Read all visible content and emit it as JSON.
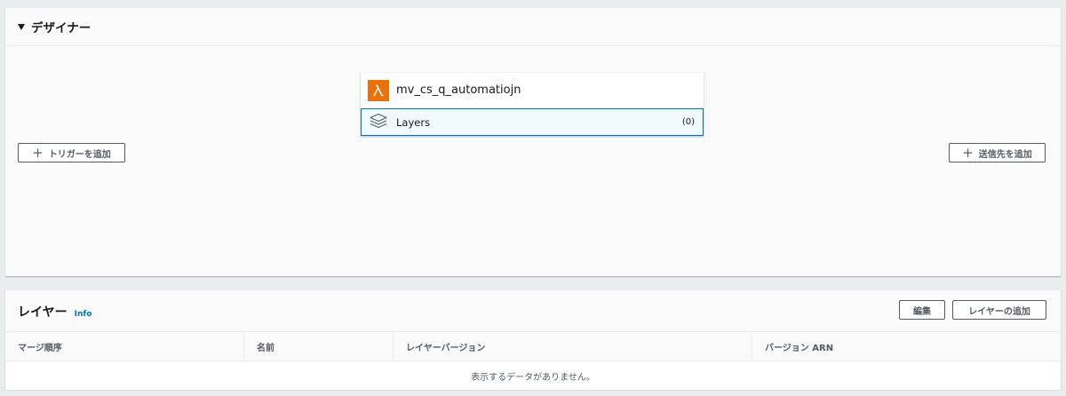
{
  "designer": {
    "title": "デザイナー",
    "function": {
      "name": "mv_cs_q_automatiojn",
      "icon": "lambda-icon",
      "icon_color": "#e8730c",
      "layers_label": "Layers",
      "layers_count": "(0)"
    },
    "add_trigger_label": "トリガーを追加",
    "add_destination_label": "送信先を追加"
  },
  "layers": {
    "title": "レイヤー",
    "info_label": "Info",
    "edit_label": "編集",
    "add_layer_label": "レイヤーの追加",
    "columns": [
      "マージ順序",
      "名前",
      "レイヤーバージョン",
      "バージョン ARN"
    ],
    "empty_message": "表示するデータがありません。"
  },
  "colors": {
    "accent": "#0073bb",
    "lambda": "#e8730c",
    "background": "#eaeded",
    "panel": "#fafafa"
  }
}
